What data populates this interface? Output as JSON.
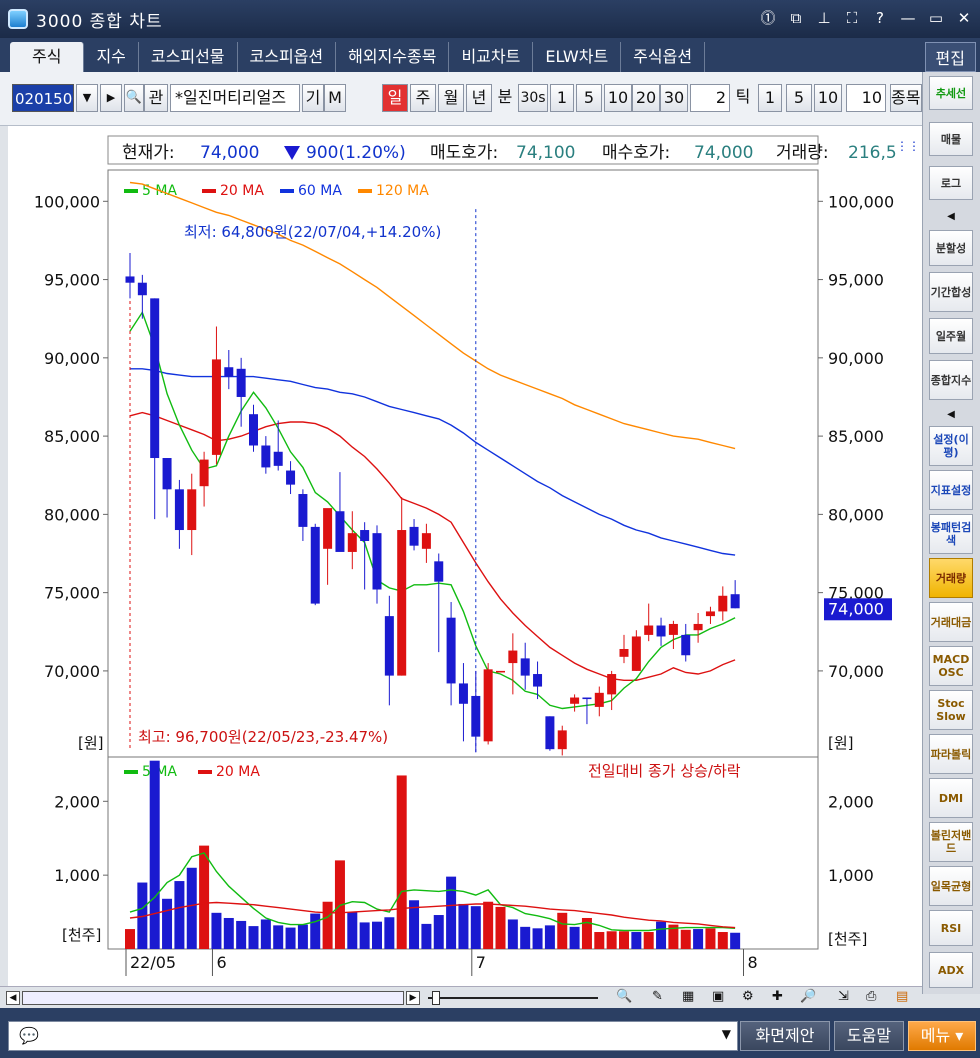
{
  "window": {
    "title": "3000 종합 차트"
  },
  "tabs": [
    "주식",
    "지수",
    "코스피선물",
    "코스피옵션",
    "해외지수종목",
    "비교차트",
    "ELW차트",
    "주식옵션"
  ],
  "tab_edit": "편집",
  "toolbar": {
    "code": "020150",
    "btn_q": "관",
    "stock_name": "*일진머티리얼즈",
    "btn_gi": "기",
    "btn_m": "M",
    "periods": [
      "일",
      "주",
      "월",
      "년"
    ],
    "minute_label": "분",
    "minute_opts": [
      "30s",
      "1",
      "5",
      "10",
      "20",
      "30"
    ],
    "minute_value": "2",
    "tick_label": "틱",
    "tick_opts": [
      "1",
      "5",
      "10"
    ],
    "tick_value": "10",
    "item_label": "종목"
  },
  "info": {
    "price_label": "현재가:",
    "price": "74,000",
    "change": "900(1.20%)",
    "ask_label": "매도호가:",
    "ask": "74,100",
    "bid_label": "매수호가:",
    "bid": "74,000",
    "vol_label": "거래량:",
    "vol": "216,5"
  },
  "legend_price": [
    {
      "name": "5 MA",
      "color": "#11bb11"
    },
    {
      "name": "20 MA",
      "color": "#dd1111"
    },
    {
      "name": "60 MA",
      "color": "#1133dd"
    },
    {
      "name": "120 MA",
      "color": "#ff8800"
    }
  ],
  "legend_vol": [
    {
      "name": "5 MA",
      "color": "#11bb11"
    },
    {
      "name": "20 MA",
      "color": "#dd1111"
    }
  ],
  "annot_low": "최저: 64,800원(22/07/04,+14.20%)",
  "annot_high": "최고: 96,700원(22/05/23,-23.47%)",
  "vol_note": "전일대비 종가 상승/하락",
  "price_unit": "[원]",
  "vol_unit": "[천주]",
  "last_price_tag": "74,000",
  "colors": {
    "up": "#dd1111",
    "down": "#1a1ad0",
    "last_tag_bg": "#1a1ad0"
  },
  "right_panel": [
    "추세선",
    "매물",
    "로그",
    "분할성",
    "기간합성",
    "일주월",
    "종합지수",
    "설정(이평)",
    "지표설정",
    "봉패턴검색",
    "거래량",
    "거래대금",
    "MACD OSC",
    "Stoc Slow",
    "파라볼릭",
    "DMI",
    "볼린저밴드",
    "일목균형",
    "RSI",
    "ADX"
  ],
  "status": {
    "btn_suggest": "화면제안",
    "btn_help": "도움말",
    "btn_menu": "메뉴 ▾"
  },
  "chart_data": [
    {
      "type": "candlestick",
      "ylim": [
        64500,
        102000
      ],
      "yticks": [
        70000,
        75000,
        80000,
        85000,
        90000,
        95000,
        100000
      ],
      "ytick_labels": [
        "70,000",
        "75,000",
        "80,000",
        "85,000",
        "90,000",
        "95,000",
        "100,000"
      ],
      "xtick_labels": [
        "22/05",
        "6",
        "7",
        "8"
      ],
      "xtick_index": [
        0,
        7,
        28,
        50
      ],
      "candles": [
        [
          95200,
          96700,
          93800,
          94800
        ],
        [
          94800,
          95300,
          92500,
          94000
        ],
        [
          93800,
          93800,
          79700,
          83600
        ],
        [
          83600,
          83600,
          79800,
          81600
        ],
        [
          81600,
          82200,
          77800,
          79000
        ],
        [
          79000,
          82600,
          77400,
          81600
        ],
        [
          81800,
          84000,
          80500,
          83500
        ],
        [
          83800,
          92000,
          83200,
          89900
        ],
        [
          89400,
          90500,
          88000,
          88800
        ],
        [
          89300,
          90000,
          85600,
          87500
        ],
        [
          86400,
          87000,
          84000,
          84400
        ],
        [
          84400,
          85000,
          82600,
          83000
        ],
        [
          84000,
          86000,
          82800,
          83100
        ],
        [
          82800,
          83400,
          81300,
          81900
        ],
        [
          81300,
          81600,
          78300,
          79200
        ],
        [
          79200,
          79400,
          74200,
          74300
        ],
        [
          77800,
          79800,
          75500,
          80400
        ],
        [
          80200,
          82700,
          78200,
          77600
        ],
        [
          77600,
          80200,
          76500,
          78800
        ],
        [
          79000,
          79500,
          75200,
          78300
        ],
        [
          78800,
          79300,
          74300,
          75200
        ],
        [
          73500,
          74800,
          67800,
          69700
        ],
        [
          69700,
          81100,
          69700,
          79000
        ],
        [
          79200,
          79700,
          77700,
          78000
        ],
        [
          77800,
          79400,
          76900,
          78800
        ],
        [
          77000,
          77500,
          71200,
          75700
        ],
        [
          73400,
          74400,
          67800,
          69200
        ],
        [
          69200,
          70500,
          65500,
          67900
        ],
        [
          68400,
          70000,
          64800,
          65800
        ],
        [
          65500,
          70500,
          65300,
          70100
        ],
        [
          69900,
          70000,
          70000,
          70000
        ],
        [
          70500,
          72400,
          68500,
          71300
        ],
        [
          70800,
          71800,
          68800,
          69700
        ],
        [
          69800,
          70600,
          68200,
          69000
        ],
        [
          67100,
          67100,
          64900,
          65000
        ],
        [
          65000,
          66500,
          64600,
          66200
        ],
        [
          67900,
          68500,
          67400,
          68300
        ],
        [
          68300,
          68300,
          66600,
          68200
        ],
        [
          67700,
          69000,
          67100,
          68600
        ],
        [
          68500,
          70000,
          67500,
          69800
        ],
        [
          70900,
          72300,
          70500,
          71400
        ],
        [
          70000,
          72600,
          70000,
          72200
        ],
        [
          72300,
          74300,
          71900,
          72900
        ],
        [
          72900,
          73400,
          71600,
          72200
        ],
        [
          72300,
          73200,
          71400,
          73000
        ],
        [
          72300,
          73000,
          70600,
          71000
        ],
        [
          72600,
          73700,
          71800,
          73000
        ],
        [
          73500,
          74100,
          73000,
          73800
        ],
        [
          73800,
          75400,
          73200,
          74800
        ],
        [
          74900,
          75800,
          74000,
          74000
        ]
      ],
      "ma5": [
        91700,
        92900,
        90700,
        87700,
        85700,
        84100,
        82900,
        83100,
        85000,
        86600,
        87800,
        86800,
        85500,
        84000,
        83000,
        81400,
        80800,
        79900,
        79000,
        78200,
        75800,
        75300,
        75100,
        75500,
        75500,
        75600,
        75500,
        73800,
        71600,
        70000,
        69800,
        69400,
        68700,
        68500,
        67800,
        67600,
        67700,
        67800,
        67900,
        68100,
        68900,
        69500,
        70600,
        71500,
        72000,
        72300,
        72300,
        72700,
        73000,
        73400
      ],
      "ma20": [
        86300,
        86500,
        86300,
        86000,
        85700,
        85400,
        85100,
        84700,
        84800,
        85000,
        85300,
        85600,
        85800,
        85900,
        85900,
        85800,
        85500,
        85000,
        84300,
        83700,
        82900,
        82000,
        81000,
        80700,
        80400,
        80000,
        79500,
        78200,
        76900,
        75700,
        74600,
        73700,
        72900,
        72200,
        71500,
        71000,
        70500,
        70100,
        69800,
        69500,
        69400,
        69400,
        69600,
        69800,
        70200,
        69900,
        69800,
        70000,
        70400,
        70700
      ],
      "ma60": [
        89300,
        89300,
        89200,
        89000,
        88900,
        88800,
        88800,
        88800,
        88800,
        88800,
        88800,
        88700,
        88600,
        88500,
        88300,
        88100,
        88000,
        87800,
        87700,
        87500,
        87200,
        86900,
        86700,
        86500,
        86300,
        86100,
        85700,
        85200,
        84600,
        84100,
        83600,
        83100,
        82600,
        82100,
        81700,
        81200,
        80800,
        80400,
        80000,
        79700,
        79300,
        79000,
        78800,
        78500,
        78300,
        78100,
        77900,
        77700,
        77500,
        77400
      ],
      "ma120": [
        101200,
        101100,
        100800,
        100500,
        100200,
        99900,
        99600,
        99300,
        99100,
        98800,
        98500,
        98200,
        97900,
        97500,
        97200,
        96800,
        96400,
        96000,
        95500,
        95000,
        94500,
        93900,
        93300,
        92700,
        92100,
        91500,
        90900,
        90300,
        89800,
        89300,
        88900,
        88600,
        88300,
        88000,
        87700,
        87400,
        87000,
        86700,
        86400,
        86100,
        85800,
        85600,
        85400,
        85200,
        85000,
        84900,
        84800,
        84600,
        84400,
        84200
      ]
    },
    {
      "type": "bar",
      "ylim": [
        0,
        2600
      ],
      "yticks": [
        1000,
        2000
      ],
      "ytick_labels": [
        "1,000",
        "2,000"
      ],
      "values": [
        270,
        900,
        2550,
        680,
        920,
        1100,
        1400,
        490,
        420,
        380,
        310,
        400,
        320,
        290,
        330,
        480,
        640,
        1200,
        500,
        360,
        370,
        430,
        2350,
        660,
        340,
        460,
        980,
        610,
        580,
        640,
        570,
        400,
        300,
        280,
        320,
        490,
        300,
        420,
        230,
        240,
        240,
        230,
        230,
        370,
        330,
        260,
        270,
        280,
        230,
        220
      ],
      "updown": [
        1,
        0,
        0,
        0,
        0,
        0,
        1,
        0,
        0,
        0,
        0,
        0,
        0,
        0,
        0,
        0,
        1,
        1,
        0,
        0,
        0,
        0,
        1,
        0,
        0,
        0,
        0,
        0,
        0,
        1,
        1,
        0,
        0,
        0,
        0,
        1,
        0,
        1,
        1,
        1,
        1,
        0,
        1,
        0,
        1,
        1,
        0,
        1,
        1,
        0
      ],
      "ma5": [
        500,
        550,
        700,
        900,
        1000,
        1250,
        1300,
        1050,
        850,
        700,
        550,
        420,
        360,
        330,
        330,
        370,
        430,
        590,
        640,
        630,
        540,
        500,
        780,
        800,
        790,
        780,
        800,
        780,
        730,
        800,
        600,
        560,
        480,
        450,
        410,
        340,
        330,
        360,
        320,
        260,
        250,
        250,
        250,
        270,
        280,
        290,
        290,
        290,
        290,
        280
      ],
      "ma20": [
        420,
        440,
        480,
        520,
        560,
        590,
        620,
        630,
        620,
        610,
        600,
        580,
        560,
        540,
        520,
        500,
        490,
        490,
        500,
        510,
        520,
        530,
        550,
        560,
        570,
        580,
        590,
        600,
        610,
        610,
        600,
        590,
        580,
        560,
        540,
        530,
        520,
        500,
        480,
        460,
        430,
        410,
        390,
        380,
        360,
        350,
        340,
        320,
        300,
        290
      ]
    }
  ]
}
